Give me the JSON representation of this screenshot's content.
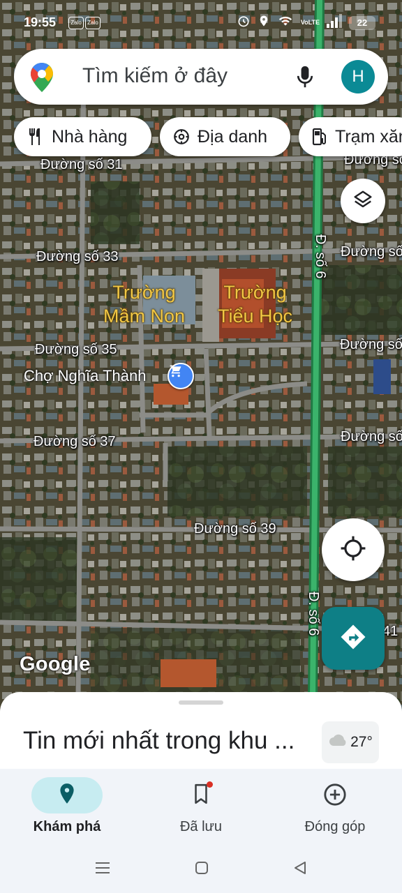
{
  "status_bar": {
    "time": "19:55",
    "app_badges": [
      "Zalo",
      "Zalo"
    ],
    "network_label": "VoLTE",
    "battery": "22"
  },
  "search": {
    "placeholder": "Tìm kiếm ở đây",
    "avatar_letter": "H"
  },
  "chips": [
    {
      "label": "Nhà hàng",
      "icon": "restaurant-icon"
    },
    {
      "label": "Địa danh",
      "icon": "landmark-icon"
    },
    {
      "label": "Trạm xăng",
      "icon": "gas-station-icon"
    }
  ],
  "map": {
    "streets": [
      "Đường số 31",
      "Đường số 33",
      "Đường số 35",
      "Đường số 37",
      "Đường số 39",
      "Đường số",
      "Đường số",
      "Đường số",
      "Đường số",
      "Đường số",
      "Đ. số 6",
      "Đ. số 6",
      "41"
    ],
    "pois": [
      "Trường\nMầm Non",
      "Trường\nTiểu Học"
    ],
    "market": "Chợ Nghĩa Thành",
    "logo": "Google"
  },
  "sheet": {
    "title": "Tin mới nhất trong khu ...",
    "weather": "27°"
  },
  "nav": [
    {
      "label": "Khám phá",
      "icon": "explore-pin-icon",
      "active": true
    },
    {
      "label": "Đã lưu",
      "icon": "bookmark-icon",
      "active": false
    },
    {
      "label": "Đóng góp",
      "icon": "add-circle-icon",
      "active": false
    }
  ],
  "colors": {
    "accent": "#0e7f86",
    "nav_active_pill": "#c7ecf1",
    "poi_label": "#f2c744",
    "highway": "#2e9e5a"
  }
}
